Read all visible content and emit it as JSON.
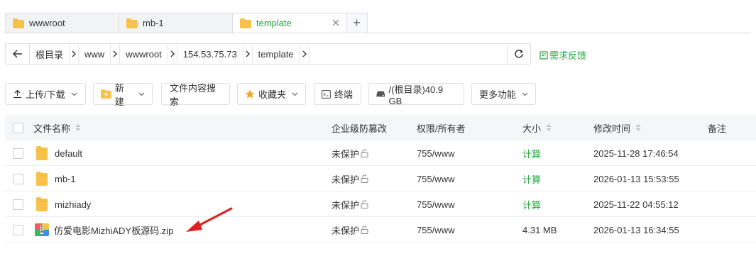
{
  "tabs": [
    {
      "label": "wwwroot",
      "active": false
    },
    {
      "label": "mb-1",
      "active": false
    },
    {
      "label": "template",
      "active": true
    }
  ],
  "tab_add_label": "+",
  "path": {
    "crumbs": [
      "根目录",
      "www",
      "wwwroot",
      "154.53.75.73",
      "template"
    ]
  },
  "feedback_label": "需求反馈",
  "toolbar": {
    "upload": "上传/下载",
    "new": "新建",
    "search_content": "文件内容搜索",
    "favorites": "收藏夹",
    "terminal": "终端",
    "disk": "/(根目录)40.9 GB",
    "more": "更多功能"
  },
  "table": {
    "headers": {
      "name": "文件名称",
      "protect": "企业级防篡改",
      "perm": "权限/所有者",
      "size": "大小",
      "mtime": "修改时间",
      "note": "备注"
    },
    "rows": [
      {
        "name": "default",
        "type": "folder",
        "protect": "未保护",
        "perm": "755/www",
        "size": "计算",
        "mtime": "2025-11-28 17:46:54"
      },
      {
        "name": "mb-1",
        "type": "folder",
        "protect": "未保护",
        "perm": "755/www",
        "size": "计算",
        "mtime": "2026-01-13 15:53:55"
      },
      {
        "name": "mizhiady",
        "type": "folder",
        "protect": "未保护",
        "perm": "755/www",
        "size": "计算",
        "mtime": "2025-11-22 04:55:12"
      },
      {
        "name": "仿爱电影MizhiADY板源码.zip",
        "type": "zip",
        "protect": "未保护",
        "perm": "755/www",
        "size": "4.31 MB",
        "mtime": "2026-01-13 16:34:55"
      }
    ]
  },
  "colors": {
    "accent": "#20a53a",
    "folder": "#f7c24a",
    "annotation_arrow": "#e02020"
  }
}
